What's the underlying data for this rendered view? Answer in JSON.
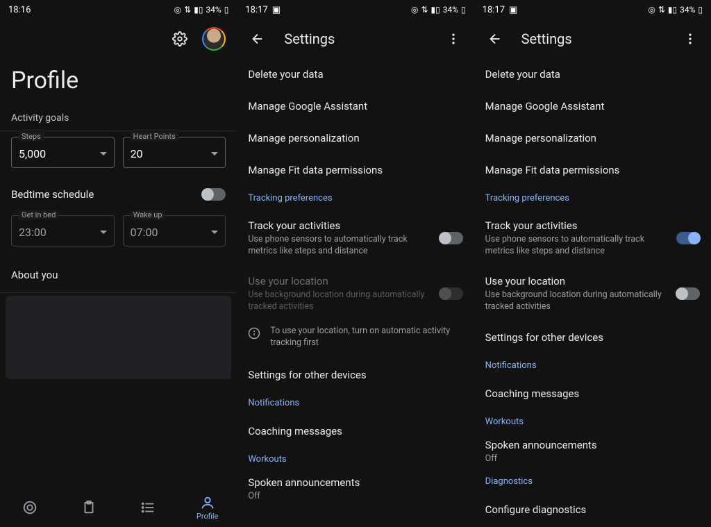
{
  "screen1": {
    "status": {
      "time": "18:16",
      "battery": "34%"
    },
    "title": "Profile",
    "activity_goals_label": "Activity goals",
    "steps": {
      "label": "Steps",
      "value": "5,000"
    },
    "heart_points": {
      "label": "Heart Points",
      "value": "20"
    },
    "bedtime": {
      "label": "Bedtime schedule",
      "get_in_bed": {
        "label": "Get in bed",
        "value": "23:00"
      },
      "wake_up": {
        "label": "Wake up",
        "value": "07:00"
      }
    },
    "about_you_label": "About you",
    "nav": {
      "profile": "Profile"
    }
  },
  "screen2": {
    "status": {
      "time": "18:17",
      "battery": "34%"
    },
    "title": "Settings",
    "items": {
      "delete_data": "Delete your data",
      "manage_assistant": "Manage Google Assistant",
      "manage_personalization": "Manage personalization",
      "manage_fit_perms": "Manage Fit data permissions"
    },
    "tracking_label": "Tracking preferences",
    "track_activities": {
      "title": "Track your activities",
      "desc": "Use phone sensors to automatically track metrics like steps and distance"
    },
    "use_location": {
      "title": "Use your location",
      "desc": "Use background location during automatically tracked activities"
    },
    "location_hint": "To use your location, turn on automatic activity tracking first",
    "other_devices": "Settings for other devices",
    "notifications_label": "Notifications",
    "coaching": "Coaching messages",
    "workouts_label": "Workouts",
    "spoken": {
      "title": "Spoken announcements",
      "state": "Off"
    }
  },
  "screen3": {
    "status": {
      "time": "18:17",
      "battery": "34%"
    },
    "title": "Settings",
    "items": {
      "delete_data": "Delete your data",
      "manage_assistant": "Manage Google Assistant",
      "manage_personalization": "Manage personalization",
      "manage_fit_perms": "Manage Fit data permissions"
    },
    "tracking_label": "Tracking preferences",
    "track_activities": {
      "title": "Track your activities",
      "desc": "Use phone sensors to automatically track metrics like steps and distance"
    },
    "use_location": {
      "title": "Use your location",
      "desc": "Use background location during automatically tracked activities"
    },
    "other_devices": "Settings for other devices",
    "notifications_label": "Notifications",
    "coaching": "Coaching messages",
    "workouts_label": "Workouts",
    "spoken": {
      "title": "Spoken announcements",
      "state": "Off"
    },
    "diagnostics_label": "Diagnostics",
    "configure_diag": "Configure diagnostics"
  }
}
